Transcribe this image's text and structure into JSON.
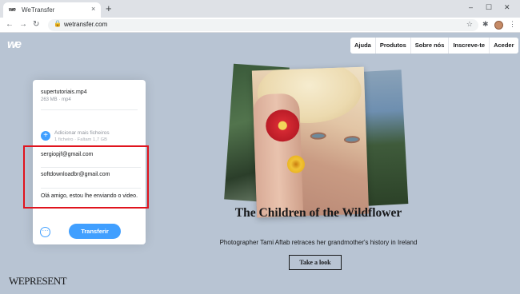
{
  "browser": {
    "tab_favicon": "we",
    "tab_title": "WeTransfer",
    "tab_close": "×",
    "new_tab": "+",
    "window_controls": [
      "–",
      "☐",
      "✕"
    ],
    "nav": {
      "back": "←",
      "forward": "→",
      "reload": "↻"
    },
    "url": "wetransfer.com",
    "lock_glyph": "🔒",
    "star_glyph": "☆",
    "extensions_glyph": "✱",
    "menu_glyph": "⋮"
  },
  "site": {
    "logo": "we",
    "nav_items": [
      "Ajuda",
      "Produtos",
      "Sobre nós",
      "Inscreve-te",
      "Aceder"
    ]
  },
  "transfer": {
    "file_name": "supertutoriais.mp4",
    "file_meta": "263 MB · mp4",
    "add_icon": "+",
    "add_label": "Adicionar mais ficheiros",
    "add_meta": "1 ficheiro · Faltam 1,7 GB",
    "email_to": "sergiopjf@gmail.com",
    "email_from": "softdownloadbr@gmail.com",
    "message": "Olá amigo, estou lhe enviando o video.",
    "more_glyph": "···",
    "transfer_label": "Transferir"
  },
  "story": {
    "headline": "The Children of the Wildflower",
    "subhead": "Photographer Tami Aftab retraces her grandmother's history in Ireland",
    "cta": "Take a look"
  },
  "footer_brand": "WEPRESENT",
  "colors": {
    "page_bg": "#b8c4d3",
    "accent": "#409fff",
    "highlight": "#e0141e"
  }
}
